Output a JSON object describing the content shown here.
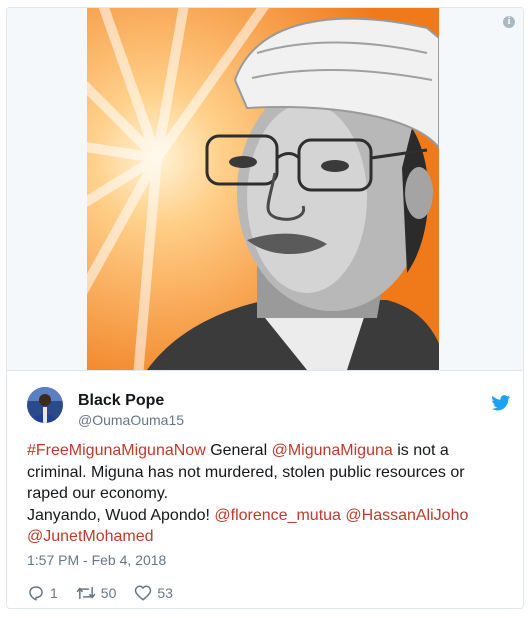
{
  "tweet": {
    "display_name": "Black Pope",
    "handle": "@OumaOuma15",
    "text_parts": {
      "hashtag": "#FreeMigunaMigunaNow",
      "t1": " General ",
      "mention1": "@MigunaMiguna",
      "t2": " is not a criminal. Miguna has not murdered, stolen public resources or raped our economy.",
      "t3": "Janyando, Wuod Apondo! ",
      "mention2": "@florence_mutua",
      "t4": " ",
      "mention3": "@HassanAliJoho",
      "mention4": "@JunetMohamed"
    },
    "timestamp": "1:57 PM - Feb 4, 2018",
    "stats": {
      "replies": "1",
      "retweets": "50",
      "likes": "53"
    }
  },
  "icons": {
    "info": "info-icon",
    "bird": "twitter-bird-icon",
    "reply": "reply-icon",
    "retweet": "retweet-icon",
    "like": "heart-icon"
  },
  "colors": {
    "link": "#c0392b",
    "twitter_blue": "#1da1f2",
    "muted": "#657786"
  }
}
